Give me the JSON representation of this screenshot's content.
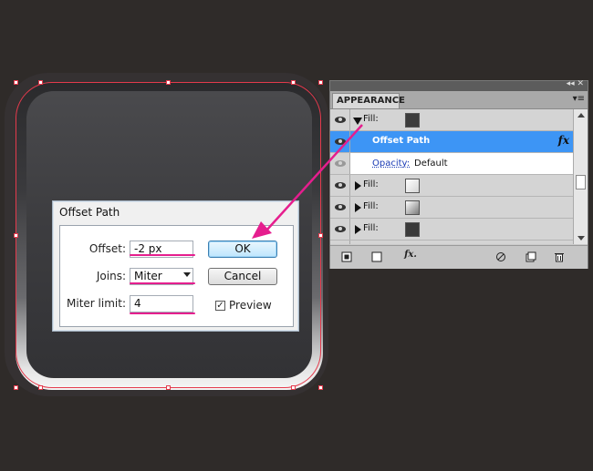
{
  "dialog": {
    "title": "Offset Path",
    "offset_label": "Offset:",
    "offset_value": "-2 px",
    "joins_label": "Joins:",
    "joins_value": "Miter",
    "miter_label": "Miter limit:",
    "miter_value": "4",
    "ok_label": "OK",
    "cancel_label": "Cancel",
    "preview_label": "Preview",
    "preview_checked": "✓"
  },
  "panel": {
    "collapse_glyph": "◂◂ ✕",
    "tab_label": "APPEARANCE",
    "menu_glyph": "▾≡",
    "rows": [
      {
        "label": "Fill:",
        "swatch": "#3c3c3c"
      },
      {
        "label": "Offset Path",
        "fx": "fx"
      },
      {
        "label": "Opacity:",
        "value": "Default"
      },
      {
        "label": "Fill:",
        "swatch": "#f0f0f0"
      },
      {
        "label": "Fill:",
        "swatch": "#c8c8c8"
      },
      {
        "label": "Fill:",
        "swatch": "#3a3a3a"
      }
    ],
    "footer_icons": [
      "new-art-icon",
      "add-stroke-icon",
      "fx-menu-icon",
      "clear-icon",
      "duplicate-icon",
      "delete-icon"
    ],
    "footer_fx": "fx."
  },
  "colors": {
    "background": "#2f2b29",
    "selection": "#e43a4c",
    "annotation": "#e51e8e",
    "panel_selected": "#3d95f5"
  }
}
